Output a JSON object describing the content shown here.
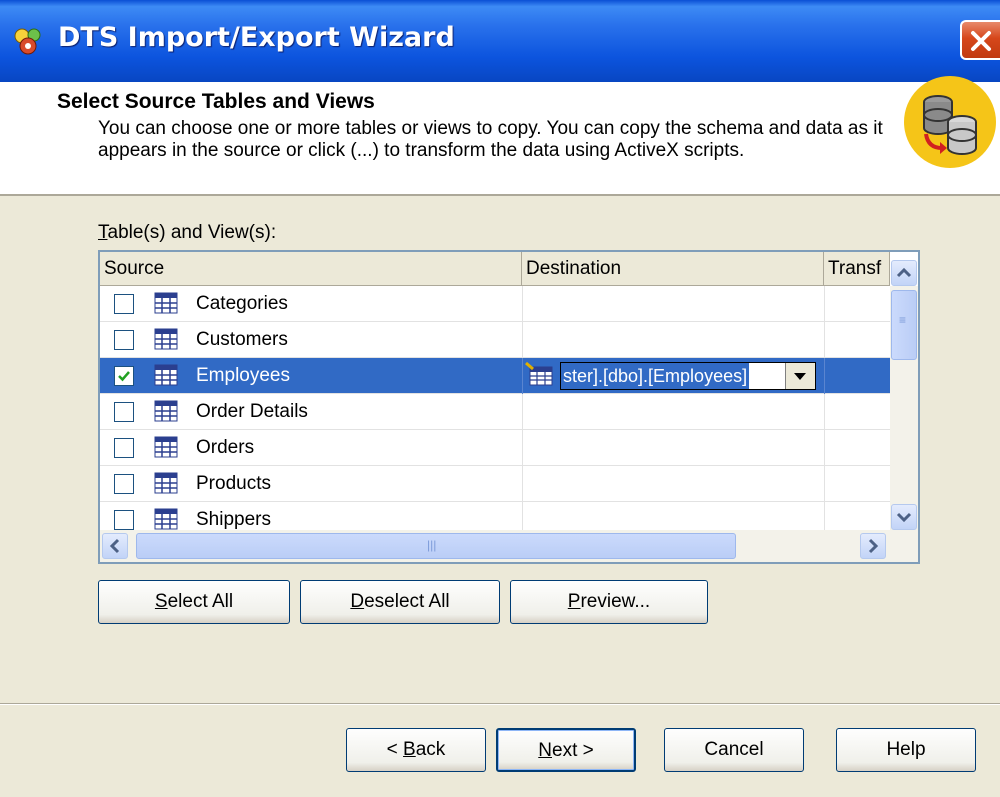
{
  "window": {
    "title": "DTS Import/Export Wizard"
  },
  "header": {
    "title": "Select Source Tables and Views",
    "description": "You can choose one or more tables or views to copy.  You can copy the schema and data as it appears in the source or click (...) to transform the data using ActiveX scripts."
  },
  "list": {
    "label_first": "T",
    "label_rest": "able(s) and View(s):",
    "columns": [
      "Source",
      "Destination",
      "Transf"
    ],
    "rows": [
      {
        "name": "Categories",
        "checked": false
      },
      {
        "name": "Customers",
        "checked": false
      },
      {
        "name": "Employees",
        "checked": true,
        "destination": "ster].[dbo].[Employees]"
      },
      {
        "name": "Order Details",
        "checked": false
      },
      {
        "name": "Orders",
        "checked": false
      },
      {
        "name": "Products",
        "checked": false
      },
      {
        "name": "Shippers",
        "checked": false
      }
    ]
  },
  "actions": {
    "select_all": {
      "accel": "S",
      "rest": "elect All"
    },
    "deselect_all": {
      "accel": "D",
      "rest": "eselect All"
    },
    "preview": {
      "accel": "P",
      "rest": "review..."
    }
  },
  "footer": {
    "back": {
      "prefix": "< ",
      "accel": "B",
      "rest": "ack"
    },
    "next": {
      "accel": "N",
      "rest": "ext >"
    },
    "cancel": "Cancel",
    "help": "Help"
  },
  "colors": {
    "selection": "#316ac5",
    "dialog_bg": "#ece9d8",
    "title_blue": "#0a4fd4"
  }
}
